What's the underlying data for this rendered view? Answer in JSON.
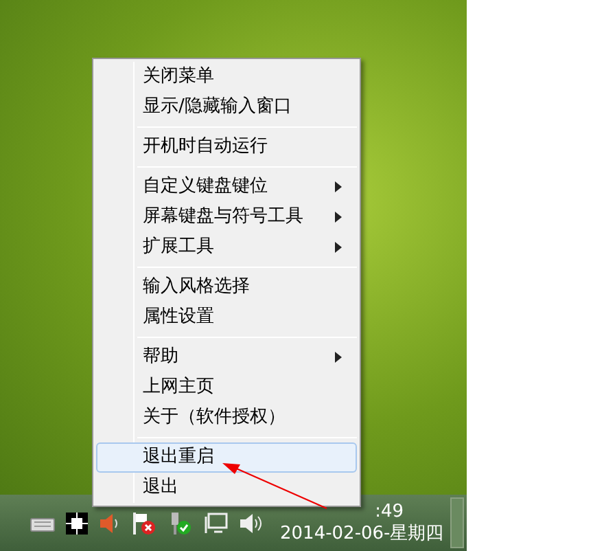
{
  "menu": {
    "groups": [
      [
        {
          "label": "关闭菜单",
          "submenu": false,
          "selected": false
        },
        {
          "label": "显示/隐藏输入窗口",
          "submenu": false,
          "selected": false
        }
      ],
      [
        {
          "label": "开机时自动运行",
          "submenu": false,
          "selected": false
        }
      ],
      [
        {
          "label": "自定义键盘键位",
          "submenu": true,
          "selected": false
        },
        {
          "label": "屏幕键盘与符号工具",
          "submenu": true,
          "selected": false
        },
        {
          "label": "扩展工具",
          "submenu": true,
          "selected": false
        }
      ],
      [
        {
          "label": "输入风格选择",
          "submenu": false,
          "selected": false
        },
        {
          "label": "属性设置",
          "submenu": false,
          "selected": false
        }
      ],
      [
        {
          "label": "帮助",
          "submenu": true,
          "selected": false
        },
        {
          "label": "上网主页",
          "submenu": false,
          "selected": false
        },
        {
          "label": "关于（软件授权）",
          "submenu": false,
          "selected": false
        }
      ],
      [
        {
          "label": "退出重启",
          "submenu": false,
          "selected": true
        },
        {
          "label": "退出",
          "submenu": false,
          "selected": false
        }
      ]
    ]
  },
  "clock": {
    "time": ":49",
    "date": "2014-02-06-星期四"
  }
}
